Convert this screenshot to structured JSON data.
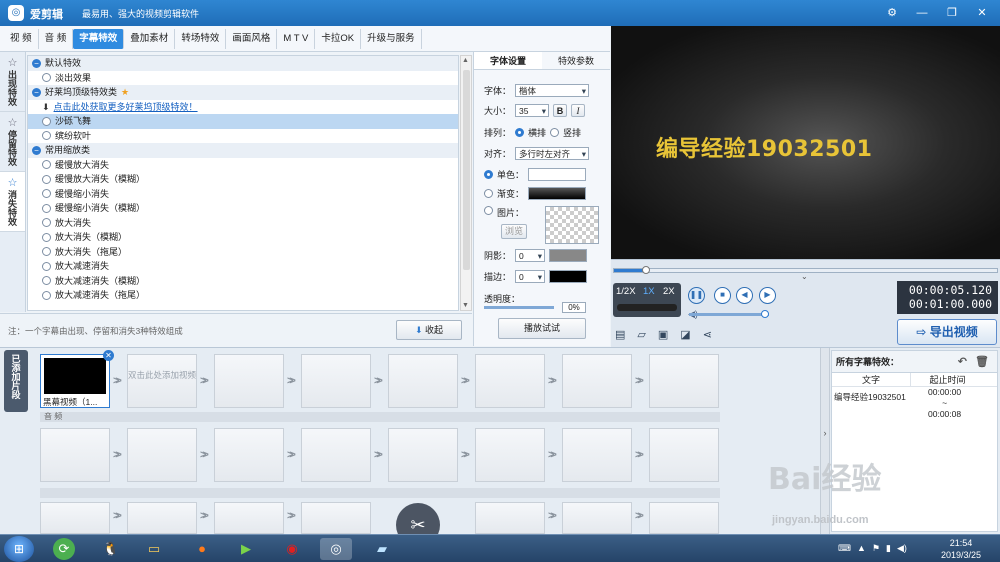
{
  "app": {
    "title": "爱剪辑",
    "slogan": "最易用、强大的视频剪辑软件",
    "window_buttons": [
      "⚙",
      "—",
      "❐",
      "✕"
    ]
  },
  "menu": [
    "视 频",
    "音 频",
    "字幕特效",
    "叠加素材",
    "转场特效",
    "画面风格",
    "M T V",
    "卡拉OK",
    "升级与服务"
  ],
  "menu_active_index": 2,
  "side_tabs": [
    {
      "label": "出现特效"
    },
    {
      "label": "停留特效"
    },
    {
      "label": "消失特效"
    }
  ],
  "effects": {
    "groups": [
      {
        "title": "默认特效",
        "items": [
          "淡出效果"
        ]
      },
      {
        "title": "好莱坞顶级特效类",
        "download_link": "点击此处获取更多好莱坞顶级特效！",
        "items": [
          "沙砾飞舞",
          "缤纷软叶"
        ]
      },
      {
        "title": "常用缩放类",
        "items": [
          "缓慢放大消失",
          "缓慢放大消失（模糊）",
          "缓慢缩小消失",
          "缓慢缩小消失（模糊）",
          "放大消失",
          "放大消失（模糊）",
          "放大消失（拖尾）",
          "放大减速消失",
          "放大减速消失（模糊）",
          "放大减速消失（拖尾）"
        ]
      }
    ],
    "selected": "沙砾飞舞"
  },
  "bottom": {
    "note": "注：一个字幕由出现、停留和消失3种特效组成",
    "collapse_label": "收起",
    "play_test_label": "播放试试"
  },
  "props": {
    "tabs": [
      "字体设置",
      "特效参数"
    ],
    "font_label": "字体：",
    "font_value": "楷体",
    "size_label": "大小：",
    "size_value": "35",
    "bold": "B",
    "italic": "I",
    "arrange_label": "排列：",
    "arrange_options": [
      "横排",
      "竖排"
    ],
    "align_label": "对齐：",
    "align_value": "多行时左对齐",
    "solid_label": "单色：",
    "gradient_label": "渐变：",
    "image_label": "图片：",
    "browse_label": "浏览",
    "shadow_label": "阴影：",
    "shadow_value": "0",
    "stroke_label": "描边：",
    "stroke_value": "0",
    "opacity_label": "透明度：",
    "opacity_value": "0%"
  },
  "preview": {
    "caption": "编导经验19032501"
  },
  "player": {
    "speeds": [
      "1/2X",
      "1X",
      "2X"
    ],
    "current_time": "00:00:05.120",
    "total_time": "00:01:00.000",
    "export_label": "导出视频"
  },
  "timeline": {
    "added_tab": "已添加片段",
    "first_clip_caption": "黑幕视频（1...",
    "add_hint": "双击此处添加视频",
    "audio_label": "音 频"
  },
  "all_effects": {
    "title": "所有字幕特效：",
    "col_text": "文字",
    "col_time": "起止时间",
    "row_text": "编导经验19032501",
    "row_start": "00:00:00",
    "row_end": "00:00:08"
  },
  "taskbar": {
    "time": "21:54",
    "date": "2019/3/25"
  },
  "watermark": {
    "text": "Bai经验",
    "url": "jingyan.baidu.com"
  },
  "colors": {
    "accent": "#2f8be0",
    "title_bar": "#1f6db8",
    "caption_text": "#e8c437"
  }
}
